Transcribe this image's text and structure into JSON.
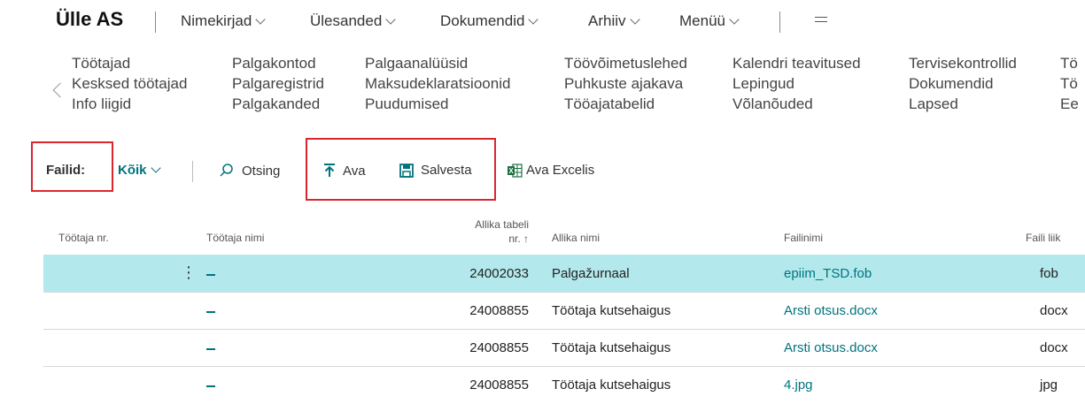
{
  "header": {
    "company": "Ülle AS",
    "menus": [
      "Nimekirjad",
      "Ülesanded",
      "Dokumendid",
      "Arhiiv",
      "Menüü"
    ]
  },
  "nav": {
    "columns": [
      [
        "Töötajad",
        "Kesksed töötajad",
        "Info liigid"
      ],
      [
        "Palgakontod",
        "Palgaregistrid",
        "Palgakanded"
      ],
      [
        "Palgaanalüüsid",
        "Maksudeklaratsioonid",
        "Puudumised"
      ],
      [
        "Töövõimetuslehed",
        "Puhkuste ajakava",
        "Tööajatabelid"
      ],
      [
        "Kalendri teavitused",
        "Lepingud",
        "Võlanõuded"
      ],
      [
        "Tervisekontrollid",
        "Dokumendid",
        "Lapsed"
      ],
      [
        "Tö",
        "Tö",
        "Ee"
      ]
    ]
  },
  "actions": {
    "label": "Failid:",
    "filter": "Kõik",
    "search": "Otsing",
    "open": "Ava",
    "save": "Salvesta",
    "excel": "Ava Excelis"
  },
  "table": {
    "headers": {
      "emp_no": "Töötaja nr.",
      "emp_name": "Töötaja nimi",
      "src_table_1": "Allika tabeli",
      "src_table_2": "nr. ↑",
      "src_name": "Allika nimi",
      "file_name": "Failinimi",
      "file_type": "Faili liik"
    },
    "rows": [
      {
        "src_table": "24002033",
        "src_name": "Palgažurnaal",
        "file_name": "epiim_TSD.fob",
        "file_type": "fob"
      },
      {
        "src_table": "24008855",
        "src_name": "Töötaja kutsehaigus",
        "file_name": "Arsti otsus.docx",
        "file_type": "docx"
      },
      {
        "src_table": "24008855",
        "src_name": "Töötaja kutsehaigus",
        "file_name": "Arsti otsus.docx",
        "file_type": "docx"
      },
      {
        "src_table": "24008855",
        "src_name": "Töötaja kutsehaigus",
        "file_name": "4.jpg",
        "file_type": "jpg"
      }
    ]
  },
  "colors": {
    "accent": "#00737e",
    "selected_row": "#b3e9ec",
    "highlight": "#d9262c"
  }
}
